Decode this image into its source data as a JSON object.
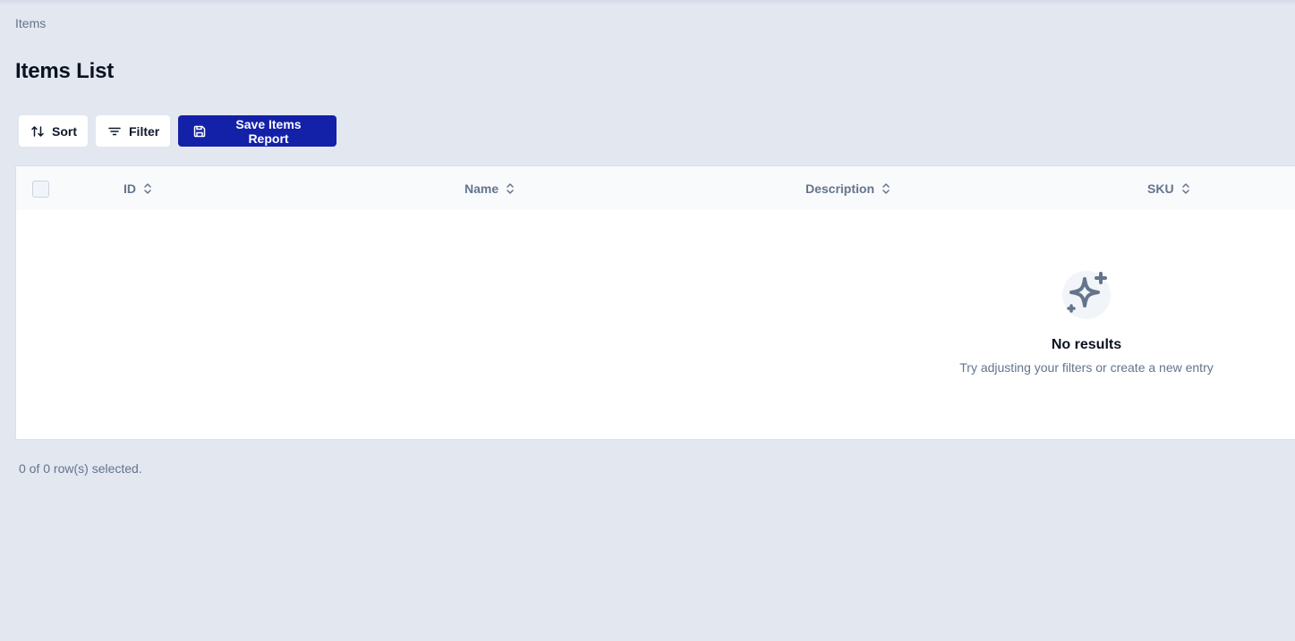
{
  "breadcrumb": {
    "current": "Items"
  },
  "page": {
    "title": "Items List"
  },
  "toolbar": {
    "sort_label": "Sort",
    "filter_label": "Filter",
    "save_label": "Save Items Report"
  },
  "table": {
    "columns": [
      {
        "key": "id",
        "label": "ID"
      },
      {
        "key": "name",
        "label": "Name"
      },
      {
        "key": "description",
        "label": "Description"
      },
      {
        "key": "sku",
        "label": "SKU"
      }
    ],
    "rows": [],
    "empty": {
      "icon": "sparkles-icon",
      "title": "No results",
      "subtitle": "Try adjusting your filters or create a new entry"
    }
  },
  "footer": {
    "selection_text": "0 of 0 row(s) selected."
  },
  "colors": {
    "background": "#e2e7f0",
    "primary": "#1320a8",
    "muted_text": "#64748b"
  }
}
